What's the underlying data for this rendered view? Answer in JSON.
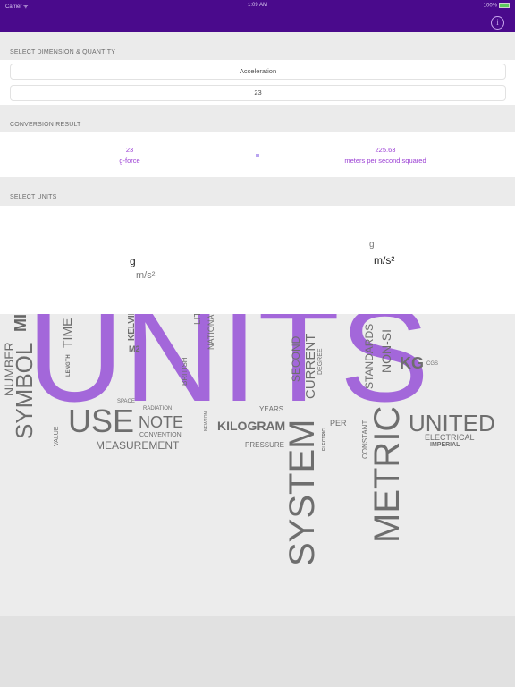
{
  "status_bar": {
    "carrier": "Carrier ᯤ",
    "time": "1:09 AM",
    "battery": "100%"
  },
  "nav": {
    "info_icon": "i"
  },
  "sections": {
    "select_dimension": "SELECT DIMENSION & QUANTITY",
    "conversion_result": "CONVERSION RESULT",
    "select_units": "SELECT UNITS"
  },
  "inputs": {
    "dimension": "Acceleration",
    "quantity": "23"
  },
  "result": {
    "from_value": "23",
    "from_unit": "g-force",
    "to_value": "225.63",
    "to_unit": "meters per second squared"
  },
  "pickers": {
    "left": {
      "selected": "g",
      "next": "m/s²"
    },
    "right": {
      "prev": "g",
      "selected": "m/s²"
    }
  },
  "word_cloud": {
    "big": "UNITS",
    "words": [
      "NUMBER",
      "SYMBOL",
      "MI",
      "TIME",
      "LENGTH",
      "KELVIN",
      "M2",
      "BRITISH",
      "NATIONAL",
      "LITER",
      "SECOND",
      "CURRENT",
      "DEGREE",
      "STANDARDS",
      "NON-SI",
      "KG",
      "CGS",
      "USE",
      "NOTE",
      "VALUE",
      "SPACE",
      "RADIATION",
      "CONVENTION",
      "MEASUREMENT",
      "NEWTON",
      "KILOGRAM",
      "PRESSURE",
      "YEARS",
      "SYSTEM",
      "ELECTRIC",
      "PER",
      "CONSTANT",
      "METRIC",
      "UNITED",
      "ELECTRICAL",
      "IMPERIAL"
    ]
  },
  "colors": {
    "nav": "#4a0a8c",
    "accent": "#9b3fd4"
  }
}
